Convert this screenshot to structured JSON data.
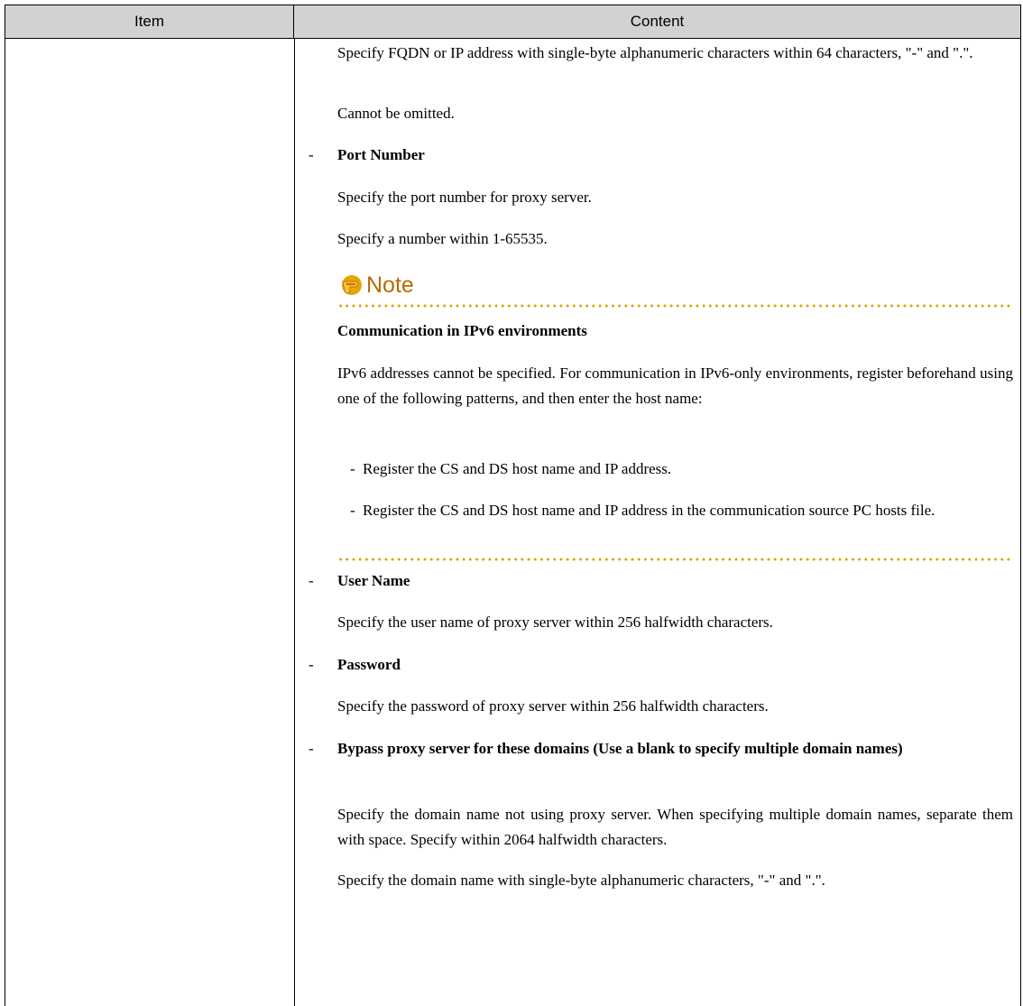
{
  "header": {
    "item": "Item",
    "content": "Content"
  },
  "hostname": {
    "spec": "Specify FQDN or IP address with single-byte alphanumeric characters within 64 characters, \"-\" and \".\".",
    "omit": "Cannot be omitted."
  },
  "port": {
    "dash": "-",
    "title": "Port Number",
    "desc1": "Specify the port number for proxy server.",
    "desc2": "Specify a number within 1-65535."
  },
  "note": {
    "title": "Note",
    "subtitle": "Communication in IPv6 environments",
    "body": "IPv6 addresses cannot be specified. For communication in IPv6-only environments, register beforehand using one of the following patterns, and then enter the host name:",
    "items": [
      "Register the CS and DS host name and IP address.",
      "Register the CS and DS host name and IP address in the communication source PC hosts file."
    ],
    "accent": "#b46e00"
  },
  "user": {
    "dash": "-",
    "title": "User Name",
    "desc": "Specify the user name of proxy server within 256 halfwidth characters."
  },
  "password": {
    "dash": "-",
    "title": "Password",
    "desc": "Specify the password of proxy server within 256 halfwidth characters."
  },
  "bypass": {
    "dash": "-",
    "title": "Bypass proxy server for these domains (Use a blank to specify multiple domain names)",
    "desc1": "Specify the domain name not using proxy server. When specifying multiple domain names, separate them with space. Specify within 2064 halfwidth characters.",
    "desc2": "Specify the domain name with single-byte alphanumeric characters, \"-\" and \".\"."
  }
}
